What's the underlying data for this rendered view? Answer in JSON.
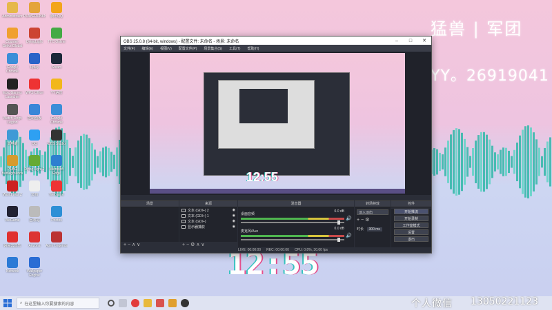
{
  "wallpaper": {
    "top_text": "猛兽 | 军团",
    "yy_text": "YY。26919041",
    "clock": "12:55"
  },
  "desktop_icons": [
    {
      "label": "Administrator",
      "color": "#e6b84a"
    },
    {
      "label": "Counter-Strike Global Off.",
      "color": "#f0a030"
    },
    {
      "label": "Google Chrome",
      "color": "#3b8ed8"
    },
    {
      "label": "Epic Games Launcher",
      "color": "#222"
    },
    {
      "label": "Watch Dogs Legion",
      "color": "#555"
    },
    {
      "label": "此电脑",
      "color": "#3f9ad6"
    },
    {
      "label": "PUBG Battlegrounds",
      "color": "#d69b2d"
    },
    {
      "label": "World War Z",
      "color": "#c22"
    },
    {
      "label": "WeGame",
      "color": "#223"
    },
    {
      "label": "网易云音乐",
      "color": "#e03030"
    },
    {
      "label": "Network",
      "color": "#2c7ad6"
    },
    {
      "label": "PLAYERUNKNOWN'S",
      "color": "#e4a43a"
    },
    {
      "label": "DyingLight",
      "color": "#c43"
    },
    {
      "label": "Uplay",
      "color": "#2a63c8"
    },
    {
      "label": "WPS Office",
      "color": "#e33"
    },
    {
      "label": "控制面板",
      "color": "#3a86d8"
    },
    {
      "label": "QQ",
      "color": "#2ea0f2"
    },
    {
      "label": "Dying Light 2",
      "color": "#6a3"
    },
    {
      "label": "文档",
      "color": "#eee"
    },
    {
      "label": "回收站",
      "color": "#bbb"
    },
    {
      "label": "Arizona",
      "color": "#d33"
    },
    {
      "label": "Wallpaper Engine",
      "color": "#2a6cd4"
    },
    {
      "label": "腾讯QQ",
      "color": "#f3a51b"
    },
    {
      "label": "TTC Online",
      "color": "#4a4"
    },
    {
      "label": "Steam",
      "color": "#1b2838"
    },
    {
      "label": "YY语音",
      "color": "#f2b71b"
    },
    {
      "label": "Google Chrome",
      "color": "#3b8ed8"
    },
    {
      "label": "OBS Studio",
      "color": "#333"
    },
    {
      "label": "Microsoft Edge",
      "color": "#2d7fd0"
    },
    {
      "label": "WeGame",
      "color": "#e33"
    },
    {
      "label": "Photos",
      "color": "#2d8fd6"
    },
    {
      "label": "Apex Legends",
      "color": "#b33"
    }
  ],
  "obs": {
    "title": "OBS 25.0.8 (64-bit, windows) - 配置文件: 未命名 - 场景: 未命名",
    "menu": [
      "文件(F)",
      "编辑(E)",
      "视图(V)",
      "配置文件(P)",
      "场景集合(S)",
      "工具(T)",
      "帮助(H)"
    ],
    "panels": {
      "scenes": "场景",
      "sources": "来源",
      "mixer": "混音器",
      "transitions": "转场特效",
      "controls": "控件"
    },
    "sources": [
      {
        "name": "文本 (GDI+) 2"
      },
      {
        "name": "文本 (GDI+) 1"
      },
      {
        "name": "文本 (GDI+)"
      },
      {
        "name": "显示器捕获"
      }
    ],
    "mixer_tracks": [
      {
        "name": "桌面音频",
        "db": "0.0 dB"
      },
      {
        "name": "麦克风/Aux",
        "db": "0.0 dB"
      }
    ],
    "transition": {
      "type": "淡入淡出",
      "duration_label": "时长",
      "duration": "300 ms"
    },
    "controls": [
      "开始推流",
      "开始录制",
      "工作室模式",
      "设置",
      "退出"
    ],
    "status": {
      "live": "LIVE: 00:00:00",
      "rec": "REC: 00:00:00",
      "cpu": "CPU: 0.8%, 30.00 fps"
    }
  },
  "taskbar": {
    "search_placeholder": "在这里输入你要搜索的内容",
    "tray_text": "个人微信",
    "tray_number": "13050221123"
  }
}
